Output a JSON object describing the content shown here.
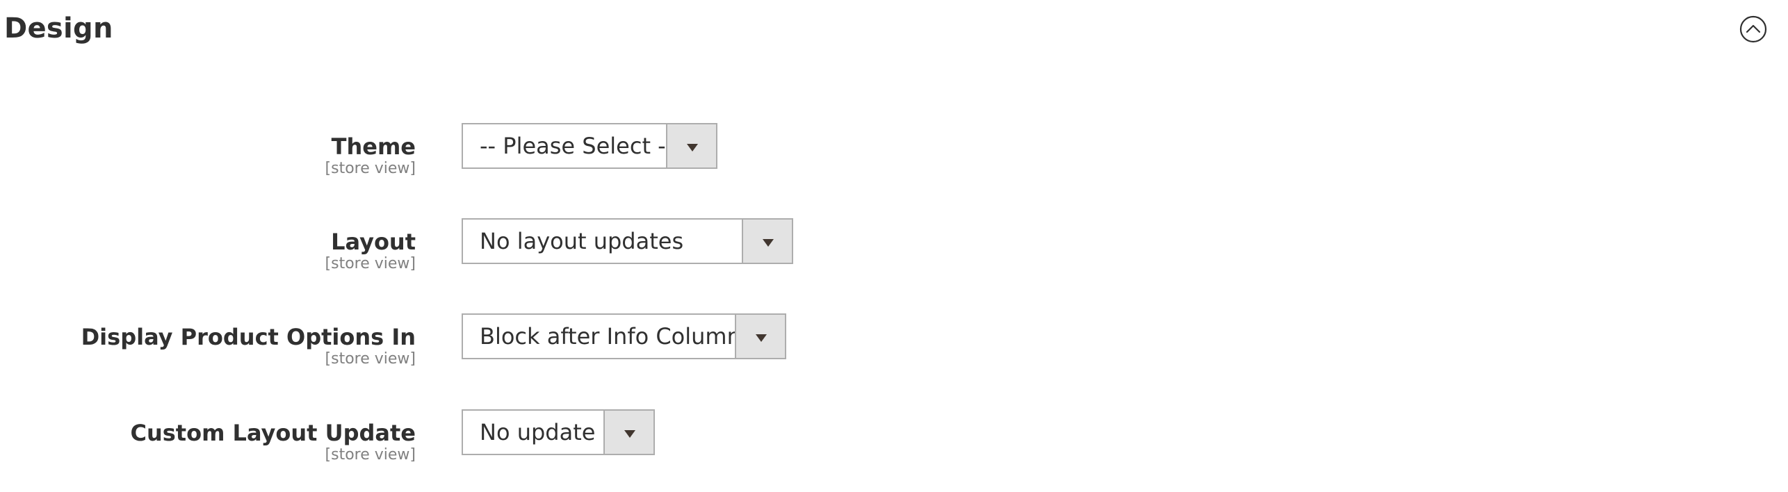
{
  "section": {
    "title": "Design",
    "toggle_icon": "chevron-up-circle-icon"
  },
  "fields": [
    {
      "label": "Theme",
      "scope": "[store view]",
      "value": "-- Please Select --"
    },
    {
      "label": "Layout",
      "scope": "[store view]",
      "value": "No layout updates"
    },
    {
      "label": "Display Product Options In",
      "scope": "[store view]",
      "value": "Block after Info Column"
    },
    {
      "label": "Custom Layout Update",
      "scope": "[store view]",
      "value": "No update"
    }
  ],
  "colors": {
    "text": "#303030",
    "scope_text": "#808080",
    "select_border": "#adadad",
    "arrow_bg": "#e3e3e3",
    "caret": "#41362f"
  }
}
